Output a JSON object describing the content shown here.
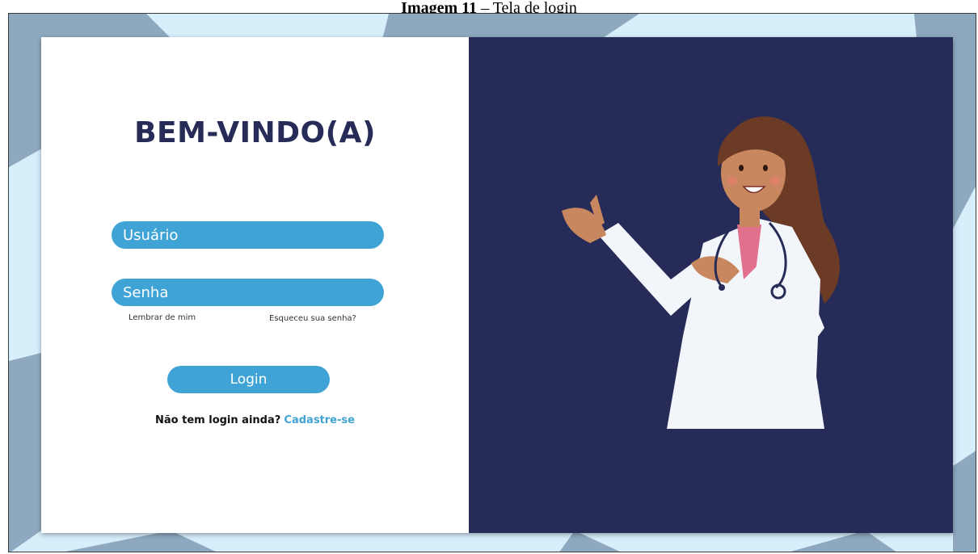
{
  "caption": {
    "bold": "Imagem 11",
    "rest": " – Tela de login"
  },
  "login": {
    "welcome": "BEM-VINDO(A)",
    "username_placeholder": "Usuário",
    "password_placeholder": "Senha",
    "remember_me": "Lembrar de mim",
    "forgot_password": "Esqueceu sua senha?",
    "login_button": "Login",
    "no_account_prompt": "Não tem login ainda?",
    "signup_link": "Cadastre-se"
  },
  "illustration": {
    "icon": "doctor-illustration"
  },
  "colors": {
    "accent": "#3fa3d5",
    "navy": "#262b57",
    "background": "#d7eefb",
    "shapes": "#8ea9bf"
  }
}
